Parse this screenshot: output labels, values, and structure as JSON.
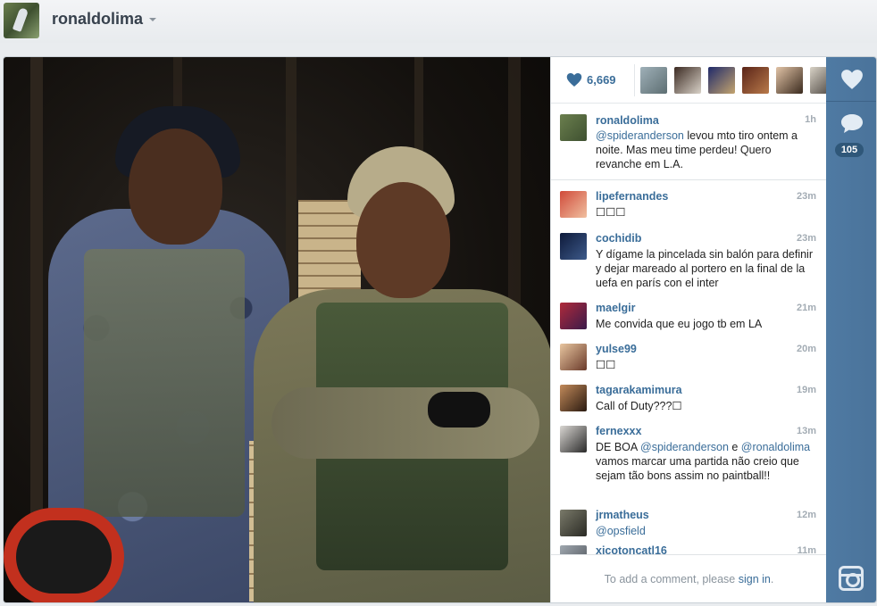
{
  "header": {
    "username": "ronaldolima"
  },
  "likes": {
    "count": "6,669",
    "likers": [
      "liker-1",
      "liker-2",
      "liker-3",
      "liker-4",
      "liker-5",
      "liker-6"
    ]
  },
  "caption": {
    "user": "ronaldolima",
    "time": "1h",
    "mention": "@spideranderson",
    "text": " levou mto tiro ontem a noite. Mas meu time perdeu! Quero revanche em L.A."
  },
  "comments": [
    {
      "user": "lipefernandes",
      "time": "23m",
      "text": "☐☐☐"
    },
    {
      "user": "cochidib",
      "time": "23m",
      "text": "Y dígame la pincelada sin balón para definir y dejar mareado al portero en la final de la uefa en parís con el inter"
    },
    {
      "user": "maelgir",
      "time": "21m",
      "text": "Me convida que eu jogo tb em LA"
    },
    {
      "user": "yulse99",
      "time": "20m",
      "text": "☐☐"
    },
    {
      "user": "tagarakamimura",
      "time": "19m",
      "text": "Call of Duty???☐"
    },
    {
      "user": "fernexxx",
      "time": "13m",
      "text_pre": "DE BOA ",
      "mention1": "@spideranderson",
      "text_mid": " e ",
      "mention2": "@ronaldolima",
      "text_post": " vamos marcar uma partida não creio que sejam tão bons assim no paintball!!"
    },
    {
      "user": "jrmatheus",
      "time": "12m",
      "mention": "@opsfield"
    },
    {
      "user": "xicotoncatl16",
      "time": "11m"
    }
  ],
  "add_comment": {
    "prefix": "To add a comment, please ",
    "link": "sign in",
    "suffix": "."
  },
  "rail": {
    "comment_count": "105"
  },
  "colors": {
    "link": "#3a6d99",
    "rail": "#4f7aa3"
  }
}
